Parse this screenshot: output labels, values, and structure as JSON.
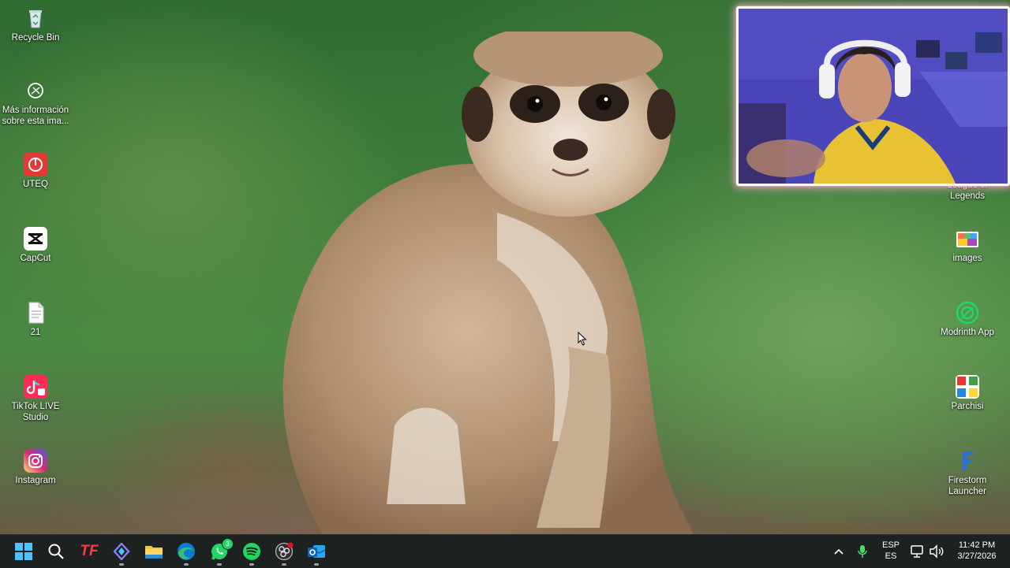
{
  "desktop_icons_left": [
    {
      "label": "Recycle Bin"
    },
    {
      "label": "Más información sobre esta ima..."
    },
    {
      "label": "UTEQ"
    },
    {
      "label": "CapCut"
    },
    {
      "label": "21"
    },
    {
      "label": "TikTok LIVE Studio"
    },
    {
      "label": "Instagram"
    }
  ],
  "desktop_icons_right": [
    {
      "label": "League of Legends"
    },
    {
      "label": "images"
    },
    {
      "label": "Modrinth App"
    },
    {
      "label": "Parchisi"
    },
    {
      "label": "Firestorm Launcher"
    }
  ],
  "taskbar": {
    "pinned": [
      {
        "icon": "windows-start-icon"
      },
      {
        "icon": "search-icon"
      },
      {
        "icon": "tf-app-icon",
        "text": "TF"
      },
      {
        "icon": "diamond-app-icon"
      },
      {
        "icon": "file-explorer-icon"
      },
      {
        "icon": "edge-browser-icon"
      },
      {
        "icon": "whatsapp-icon",
        "badge": "3"
      },
      {
        "icon": "spotify-icon"
      },
      {
        "icon": "obs-icon"
      },
      {
        "icon": "outlook-icon"
      }
    ],
    "tray": {
      "language_top": "ESP",
      "language_bottom": "ES",
      "time": "11:42 PM",
      "date": "3/27/2026"
    }
  },
  "colors": {
    "taskbar": "#1d2120",
    "whatsapp": "#25d366",
    "spotify": "#1ed760",
    "webcam_glow": "#ffaad2"
  }
}
